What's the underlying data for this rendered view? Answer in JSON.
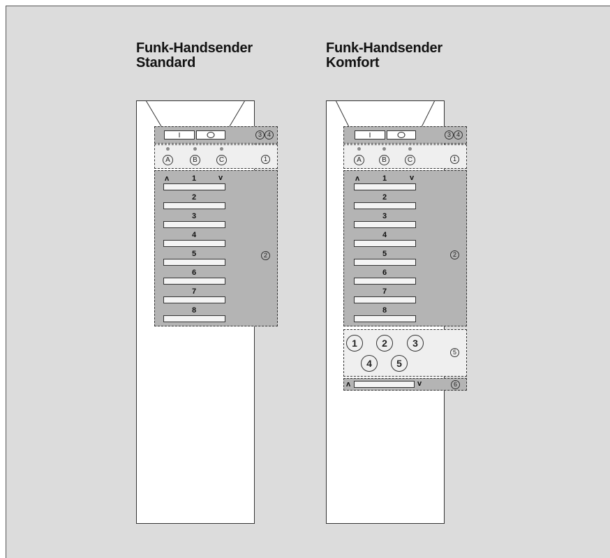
{
  "remotes": [
    {
      "title_line1": "Funk-Handsender",
      "title_line2": "Standard",
      "toggle": {
        "on_symbol": "I",
        "off_symbol": "O"
      },
      "channels": [
        "A",
        "B",
        "C"
      ],
      "buttons": [
        "1",
        "2",
        "3",
        "4",
        "5",
        "6",
        "7",
        "8"
      ],
      "up_arrow": "ʌ",
      "down_arrow": "v",
      "callouts": {
        "toggle_zone": [
          "3",
          "4"
        ],
        "channel_zone": "1",
        "button_zone": "2"
      }
    },
    {
      "title_line1": "Funk-Handsender",
      "title_line2": "Komfort",
      "toggle": {
        "on_symbol": "I",
        "off_symbol": "O"
      },
      "channels": [
        "A",
        "B",
        "C"
      ],
      "buttons": [
        "1",
        "2",
        "3",
        "4",
        "5",
        "6",
        "7",
        "8"
      ],
      "up_arrow": "ʌ",
      "down_arrow": "v",
      "groups": [
        "1",
        "2",
        "3",
        "4",
        "5"
      ],
      "callouts": {
        "toggle_zone": [
          "3",
          "4"
        ],
        "channel_zone": "1",
        "button_zone": "2",
        "group_zone": "5",
        "slider_zone": "6"
      }
    }
  ],
  "colors": {
    "background": "#dcdcdc",
    "zone_dark": "#b4b4b4",
    "zone_light": "#efefef"
  }
}
